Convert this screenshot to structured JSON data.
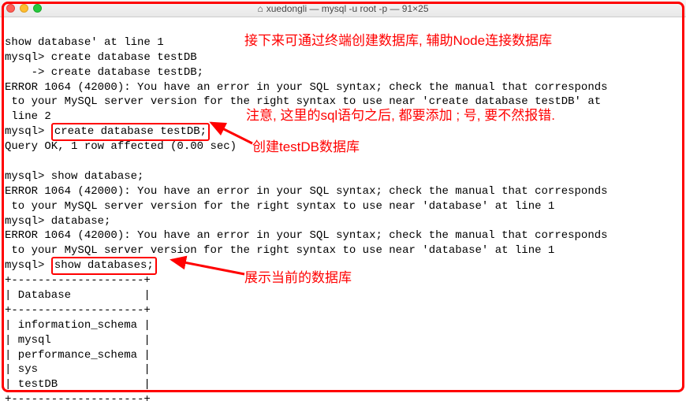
{
  "titlebar": {
    "title": "xuedongli — mysql -u root -p — 91×25"
  },
  "term": {
    "line1": "show database' at line 1",
    "prompt1": "mysql> create database testDB",
    "cont1": "    -> create database testDB;",
    "err1a": "ERROR 1064 (42000): You have an error in your SQL syntax; check the manual that corresponds",
    "err1b": " to your MySQL server version for the right syntax to use near 'create database testDB' at",
    "err1c": " line 2",
    "prompt2_pre": "mysql> ",
    "prompt2_cmd": "create database testDB;",
    "ok": "Query OK, 1 row affected (0.00 sec)",
    "blank1": "",
    "prompt3": "mysql> show database;",
    "err2a": "ERROR 1064 (42000): You have an error in your SQL syntax; check the manual that corresponds",
    "err2b": " to your MySQL server version for the right syntax to use near 'database' at line 1",
    "prompt4": "mysql> database;",
    "err3a": "ERROR 1064 (42000): You have an error in your SQL syntax; check the manual that corresponds",
    "err3b": " to your MySQL server version for the right syntax to use near 'database' at line 1",
    "prompt5_pre": "mysql> ",
    "prompt5_cmd": "show databases;",
    "tbl_top": "+--------------------+",
    "tbl_hdr": "| Database           |",
    "tbl_sep": "+--------------------+",
    "tbl_r1": "| information_schema |",
    "tbl_r2": "| mysql              |",
    "tbl_r3": "| performance_schema |",
    "tbl_r4": "| sys                |",
    "tbl_r5": "| testDB             |",
    "tbl_bot": "+--------------------+"
  },
  "annotations": {
    "a1": "接下来可通过终端创建数据库, 辅助Node连接数据库",
    "a2": "注意, 这里的sql语句之后, 都要添加 ; 号, 要不然报错.",
    "a3": "创建testDB数据库",
    "a4": "展示当前的数据库"
  }
}
